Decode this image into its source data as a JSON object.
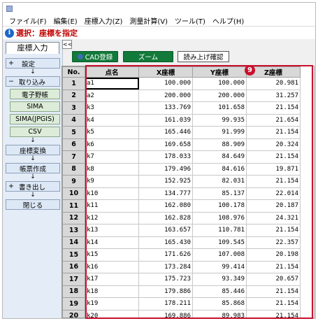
{
  "menubar": [
    "ファイル(F)",
    "編集(E)",
    "座標入力(Z)",
    "測量計算(V)",
    "ツール(T)",
    "ヘルプ(H)"
  ],
  "mode": {
    "text": "選択：座標を指定"
  },
  "panel": {
    "tab": "座標入力",
    "setting": "設定",
    "setting_mark": "+",
    "import": "取り込み",
    "import_mark": "−",
    "import_items": [
      "電子野帳",
      "SIMA",
      "SIMA(JPGIS)",
      "CSV"
    ],
    "convert": "座標変換",
    "report": "帳票作成",
    "export": "書き出し",
    "export_mark": "+",
    "close": "閉じる",
    "arrow": "↓"
  },
  "toolbar": {
    "collapse": "<<",
    "cad": "CAD登録",
    "zoom": "ズーム",
    "read": "読み上げ確認"
  },
  "badge": "9",
  "table": {
    "headers": [
      "No.",
      "点名",
      "X座標",
      "Y座標",
      "Z座標"
    ],
    "rows": [
      [
        "1",
        "a1",
        "100.000",
        "100.000",
        "20.981"
      ],
      [
        "2",
        "a2",
        "200.000",
        "200.000",
        "31.257"
      ],
      [
        "3",
        "k3",
        "133.769",
        "101.658",
        "21.154"
      ],
      [
        "4",
        "k4",
        "161.039",
        "99.935",
        "21.654"
      ],
      [
        "5",
        "k5",
        "165.446",
        "91.999",
        "21.154"
      ],
      [
        "6",
        "k6",
        "169.658",
        "88.909",
        "20.324"
      ],
      [
        "7",
        "k7",
        "178.033",
        "84.649",
        "21.154"
      ],
      [
        "8",
        "k8",
        "179.496",
        "84.616",
        "19.871"
      ],
      [
        "9",
        "k9",
        "152.925",
        "82.031",
        "21.154"
      ],
      [
        "10",
        "k10",
        "134.777",
        "85.137",
        "22.014"
      ],
      [
        "11",
        "k11",
        "162.080",
        "100.178",
        "20.187"
      ],
      [
        "12",
        "k12",
        "162.828",
        "108.976",
        "24.321"
      ],
      [
        "13",
        "k13",
        "163.657",
        "110.781",
        "21.154"
      ],
      [
        "14",
        "k14",
        "165.430",
        "109.545",
        "22.357"
      ],
      [
        "15",
        "k15",
        "171.626",
        "107.008",
        "20.198"
      ],
      [
        "16",
        "k16",
        "173.284",
        "99.414",
        "21.154"
      ],
      [
        "17",
        "k17",
        "175.723",
        "93.349",
        "20.657"
      ],
      [
        "18",
        "k18",
        "179.886",
        "85.446",
        "21.154"
      ],
      [
        "19",
        "k19",
        "178.211",
        "85.868",
        "21.154"
      ],
      [
        "20",
        "k20",
        "169.886",
        "89.983",
        "21.154"
      ]
    ]
  }
}
